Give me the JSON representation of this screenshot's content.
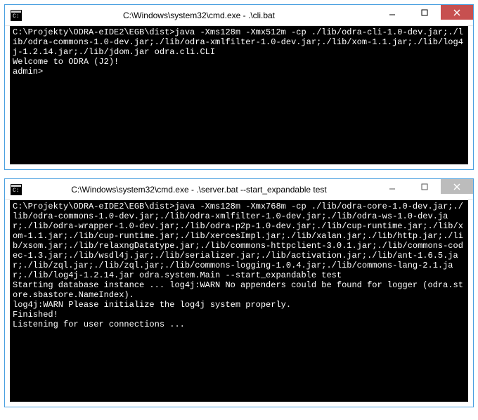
{
  "windows": [
    {
      "title": "C:\\Windows\\system32\\cmd.exe - .\\cli.bat",
      "close_style": "active",
      "content": "C:\\Projekty\\ODRA-eIDE2\\EGB\\dist>java -Xms128m -Xmx512m -cp ./lib/odra-cli-1.0-dev.jar;./lib/odra-commons-1.0-dev.jar;./lib/odra-xmlfilter-1.0-dev.jar;./lib/xom-1.1.jar;./lib/log4j-1.2.14.jar;./lib/jdom.jar odra.cli.CLI\nWelcome to ODRA (J2)!\nadmin>"
    },
    {
      "title": "C:\\Windows\\system32\\cmd.exe - .\\server.bat  --start_expandable test",
      "close_style": "inactive",
      "content": "C:\\Projekty\\ODRA-eIDE2\\EGB\\dist>java -Xms128m -Xmx768m -cp ./lib/odra-core-1.0-dev.jar;./lib/odra-commons-1.0-dev.jar;./lib/odra-xmlfilter-1.0-dev.jar;./lib/odra-ws-1.0-dev.jar;./lib/odra-wrapper-1.0-dev.jar;./lib/odra-p2p-1.0-dev.jar;./lib/cup-runtime.jar;./lib/xom-1.1.jar;./lib/cup-runtime.jar;./lib/xercesImpl.jar;./lib/xalan.jar;./lib/http.jar;./lib/xsom.jar;./lib/relaxngDatatype.jar;./lib/commons-httpclient-3.0.1.jar;./lib/commons-codec-1.3.jar;./lib/wsdl4j.jar;./lib/serializer.jar;./lib/activation.jar;./lib/ant-1.6.5.jar;./lib/zql.jar;./lib/zql.jar;./lib/commons-logging-1.0.4.jar;./lib/commons-lang-2.1.jar;./lib/log4j-1.2.14.jar odra.system.Main --start_expandable test\nStarting database instance ... log4j:WARN No appenders could be found for logger (odra.store.sbastore.NameIndex).\nlog4j:WARN Please initialize the log4j system properly.\nFinished!\nListening for user connections ..."
    }
  ]
}
